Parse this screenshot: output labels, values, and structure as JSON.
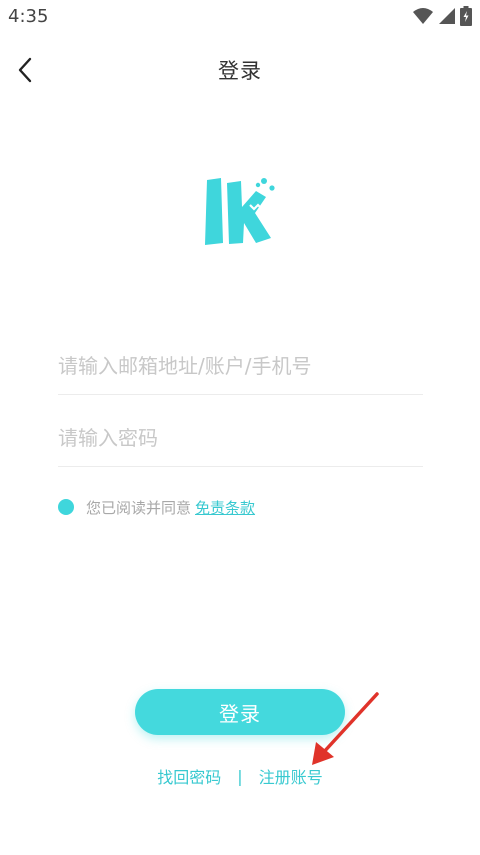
{
  "status_bar": {
    "time": "4:35",
    "icons": [
      "wifi-icon",
      "signal-icon",
      "battery-icon"
    ]
  },
  "nav": {
    "back_icon": "chevron-left-icon",
    "title": "登录"
  },
  "logo": {
    "icon": "lk-logo",
    "color": "#3fd6dc"
  },
  "form": {
    "account": {
      "placeholder": "请输入邮箱地址/账户/手机号",
      "value": ""
    },
    "password": {
      "placeholder": "请输入密码",
      "value": ""
    }
  },
  "agreement": {
    "text": "您已阅读并同意",
    "link": "免责条款",
    "checked": true
  },
  "login_button": {
    "label": "登录"
  },
  "links": {
    "forgot_password": "找回密码",
    "separator": "|",
    "register": "注册账号"
  },
  "colors": {
    "accent": "#44d9dd",
    "link": "#38c9d0",
    "annotation": "#e0332a"
  }
}
